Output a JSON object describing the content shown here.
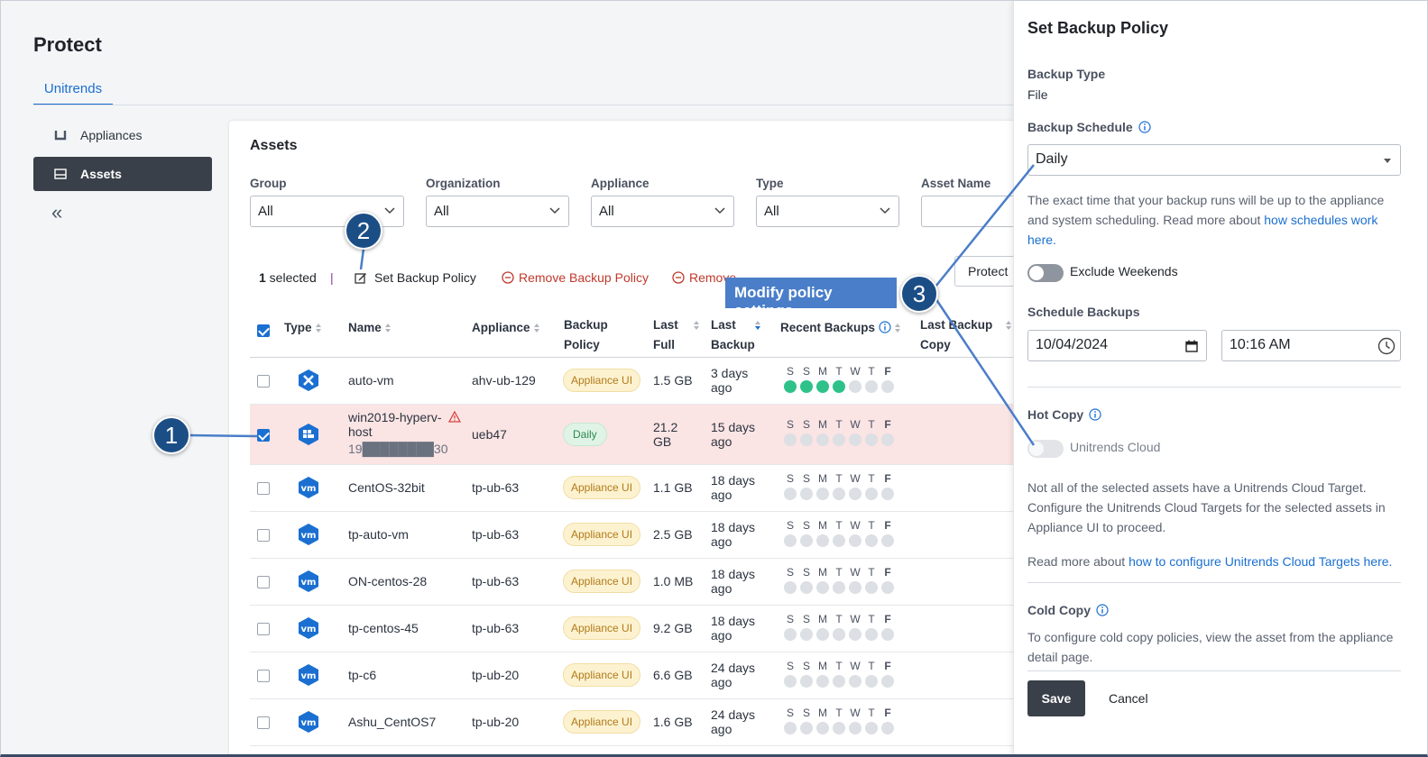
{
  "page": {
    "title": "Protect",
    "tab": "Unitrends"
  },
  "sidebar": {
    "items": [
      {
        "label": "Appliances",
        "icon": "appliance-icon",
        "active": false
      },
      {
        "label": "Assets",
        "icon": "assets-icon",
        "active": true
      }
    ],
    "collapse_glyph": "«"
  },
  "assets": {
    "title": "Assets",
    "filters": [
      {
        "label": "Group",
        "value": "All"
      },
      {
        "label": "Organization",
        "value": "All"
      },
      {
        "label": "Appliance",
        "value": "All"
      },
      {
        "label": "Type",
        "value": "All"
      },
      {
        "label": "Asset Name",
        "value": ""
      }
    ],
    "selection": {
      "count": "1",
      "count_suffix": " selected",
      "separator": "|",
      "set_policy": "Set Backup Policy",
      "remove_policy": "Remove Backup Policy",
      "remove": "Remove",
      "protect": "Protect"
    },
    "columns": {
      "type": "Type",
      "name": "Name",
      "appliance": "Appliance",
      "policy": [
        "Backup",
        "Policy"
      ],
      "last_full": [
        "Last",
        "Full"
      ],
      "last_backup": [
        "Last",
        "Backup"
      ],
      "recent": "Recent Backups",
      "last_copy": [
        "Last Backup",
        "Copy"
      ]
    },
    "day_letters": [
      "S",
      "S",
      "M",
      "T",
      "W",
      "T",
      "F"
    ],
    "rows": [
      {
        "type": "ahv",
        "name": "auto-vm",
        "appliance": "ahv-ub-129",
        "policy": "Appliance UI",
        "last_full": "1.5 GB",
        "last_backup": [
          "3 days",
          "ago"
        ],
        "dots": [
          1,
          1,
          1,
          1,
          0,
          0,
          0
        ],
        "checked": false
      },
      {
        "type": "hyperv",
        "name": "win2019-hyperv-",
        "name2": "host",
        "ip": "19████████30",
        "warning": true,
        "appliance": "ueb47",
        "policy": "Daily",
        "last_full": [
          "21.2",
          "GB"
        ],
        "last_backup": [
          "15 days",
          "ago"
        ],
        "dots": [
          0,
          0,
          0,
          0,
          0,
          0,
          0
        ],
        "checked": true
      },
      {
        "type": "vm",
        "name": "CentOS-32bit",
        "appliance": "tp-ub-63",
        "policy": "Appliance UI",
        "last_full": "1.1 GB",
        "last_backup": [
          "18 days",
          "ago"
        ],
        "dots": [
          0,
          0,
          0,
          0,
          0,
          0,
          0
        ],
        "checked": false
      },
      {
        "type": "vm",
        "name": "tp-auto-vm",
        "appliance": "tp-ub-63",
        "policy": "Appliance UI",
        "last_full": "2.5 GB",
        "last_backup": [
          "18 days",
          "ago"
        ],
        "dots": [
          0,
          0,
          0,
          0,
          0,
          0,
          0
        ],
        "checked": false
      },
      {
        "type": "vm",
        "name": "ON-centos-28",
        "appliance": "tp-ub-63",
        "policy": "Appliance UI",
        "last_full": "1.0 MB",
        "last_backup": [
          "18 days",
          "ago"
        ],
        "dots": [
          0,
          0,
          0,
          0,
          0,
          0,
          0
        ],
        "checked": false
      },
      {
        "type": "vm",
        "name": "tp-centos-45",
        "appliance": "tp-ub-63",
        "policy": "Appliance UI",
        "last_full": "9.2 GB",
        "last_backup": [
          "18 days",
          "ago"
        ],
        "dots": [
          0,
          0,
          0,
          0,
          0,
          0,
          0
        ],
        "checked": false
      },
      {
        "type": "vm",
        "name": "tp-c6",
        "appliance": "tp-ub-20",
        "policy": "Appliance UI",
        "last_full": "6.6 GB",
        "last_backup": [
          "24 days",
          "ago"
        ],
        "dots": [
          0,
          0,
          0,
          0,
          0,
          0,
          0
        ],
        "checked": false
      },
      {
        "type": "vm",
        "name": "Ashu_CentOS7",
        "appliance": "tp-ub-20",
        "policy": "Appliance UI",
        "last_full": "1.6 GB",
        "last_backup": [
          "24 days",
          "ago"
        ],
        "dots": [
          0,
          0,
          0,
          0,
          0,
          0,
          0
        ],
        "checked": false
      }
    ]
  },
  "drawer": {
    "title": "Set Backup Policy",
    "backup_type_label": "Backup Type",
    "backup_type_value": "File",
    "schedule_label": "Backup Schedule",
    "schedule_value": "Daily",
    "schedule_note": "The exact time that your backup runs will be up to the appliance and system scheduling. Read more about ",
    "schedule_link": "how schedules work here.",
    "exclude_weekends": "Exclude Weekends",
    "schedule_backups_label": "Schedule Backups",
    "date_value": "10/04/2024",
    "time_value": "10:16 AM",
    "hot_copy_label": "Hot Copy",
    "hot_copy_toggle": "Unitrends Cloud",
    "hot_copy_note": "Not all of the selected assets have a Unitrends Cloud Target. Configure the Unitrends Cloud Targets for the selected assets in Appliance UI to proceed.",
    "read_more_prefix": "Read more about ",
    "read_more_link": "how to configure Unitrends Cloud Targets here.",
    "cold_copy_label": "Cold Copy",
    "cold_copy_note": "To configure cold copy policies, view the asset from the appliance detail page.",
    "save": "Save",
    "cancel": "Cancel"
  },
  "annotations": {
    "badge1": "1",
    "badge2": "2",
    "badge3": "3",
    "callout": "Modify policy settings"
  },
  "colors": {
    "accent": "#1a6fd1",
    "badge": "#1c4e86",
    "callout": "#4a7ec9",
    "success": "#2ec28a"
  }
}
